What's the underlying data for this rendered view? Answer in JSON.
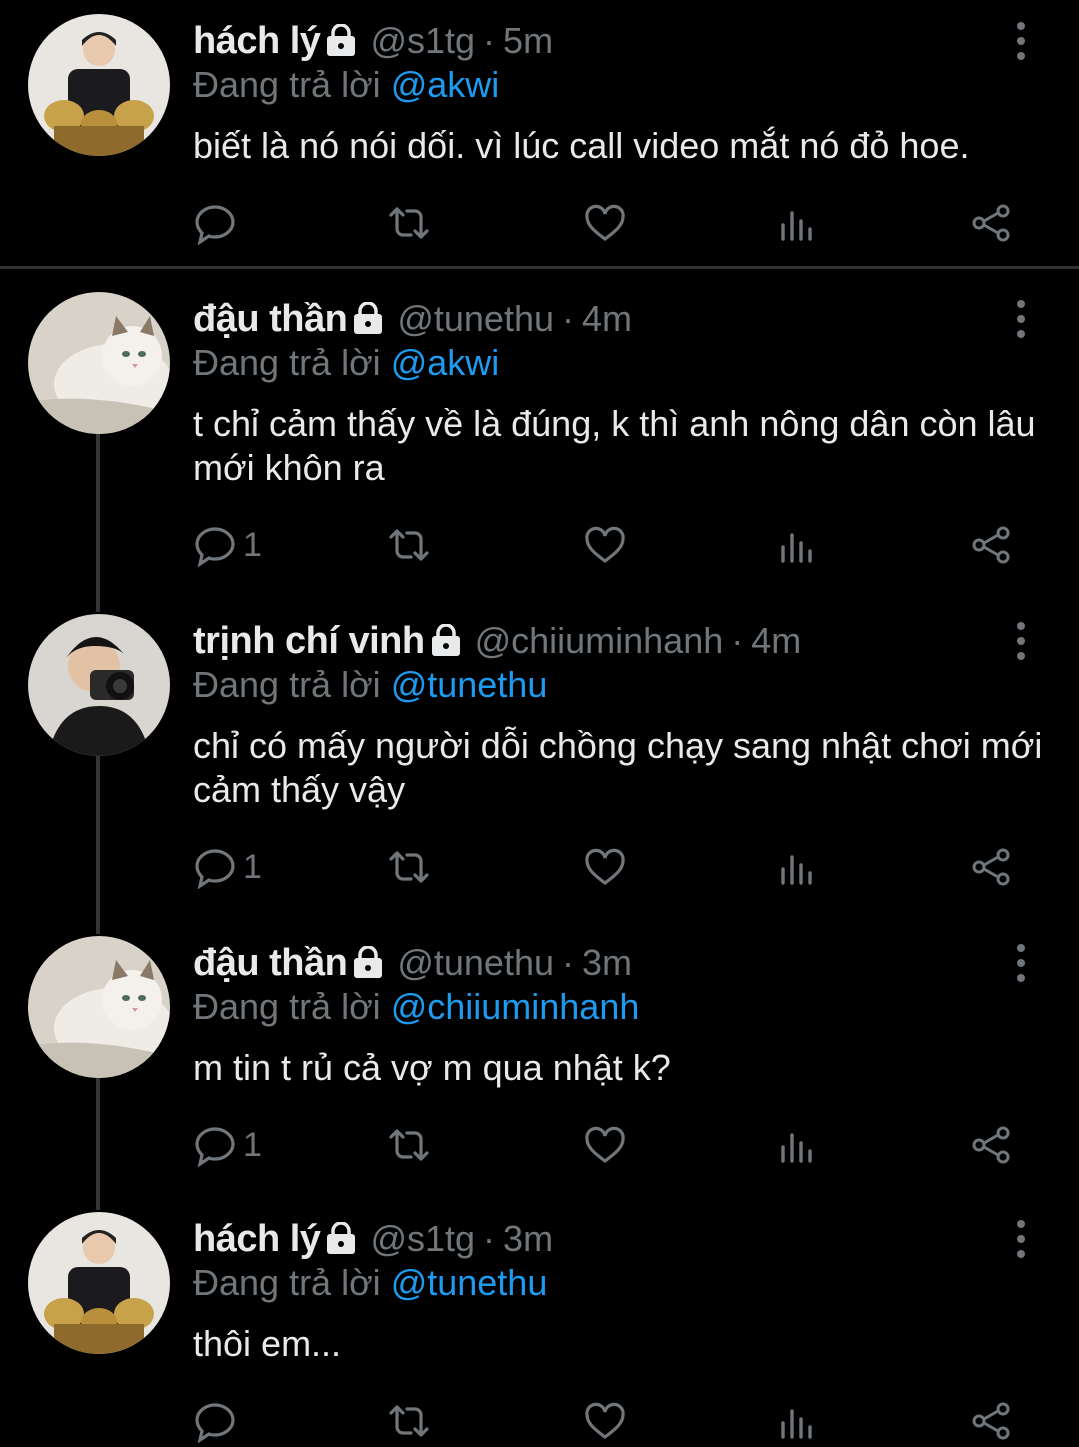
{
  "colors": {
    "background": "#000000",
    "text": "#e7e9ea",
    "muted": "#71767b",
    "link": "#1d9bf0"
  },
  "tweets": [
    {
      "name": "hách lý",
      "handle": "@s1tg",
      "sep": "·",
      "time": "5m",
      "reply_prefix": "Đang trả lời",
      "reply_to": "@akwi",
      "text": "biết là nó nói dối. vì lúc call video mắt nó đỏ hoe.",
      "reply_count": "",
      "avatar": "person-trophies-avatar",
      "locked_icon": "lock-icon"
    },
    {
      "name": "đậu thần",
      "handle": "@tunethu",
      "sep": "·",
      "time": "4m",
      "reply_prefix": "Đang trả lời",
      "reply_to": "@akwi",
      "text": "t chỉ cảm thấy về là đúng, k thì anh nông dân còn lâu mới khôn ra",
      "reply_count": "1",
      "avatar": "cat-avatar",
      "locked_icon": "lock-icon"
    },
    {
      "name": "trịnh chí vinh",
      "handle": "@chiiuminhanh",
      "sep": "·",
      "time": "4m",
      "reply_prefix": "Đang trả lời",
      "reply_to": "@tunethu",
      "text": "chỉ có mấy người dỗi chồng chạy sang nhật chơi mới cảm thấy vậy",
      "reply_count": "1",
      "avatar": "camera-person-avatar",
      "locked_icon": "lock-icon"
    },
    {
      "name": "đậu thần",
      "handle": "@tunethu",
      "sep": "·",
      "time": "3m",
      "reply_prefix": "Đang trả lời",
      "reply_to": "@chiiuminhanh",
      "text": "m tin t rủ cả vợ m qua nhật k?",
      "reply_count": "1",
      "avatar": "cat-avatar",
      "locked_icon": "lock-icon"
    },
    {
      "name": "hách lý",
      "handle": "@s1tg",
      "sep": "·",
      "time": "3m",
      "reply_prefix": "Đang trả lời",
      "reply_to": "@tunethu",
      "text": "thôi em...",
      "reply_count": "",
      "avatar": "person-trophies-avatar",
      "locked_icon": "lock-icon"
    }
  ],
  "action_icons": [
    "reply-icon",
    "retweet-icon",
    "like-icon",
    "views-icon",
    "share-icon"
  ]
}
